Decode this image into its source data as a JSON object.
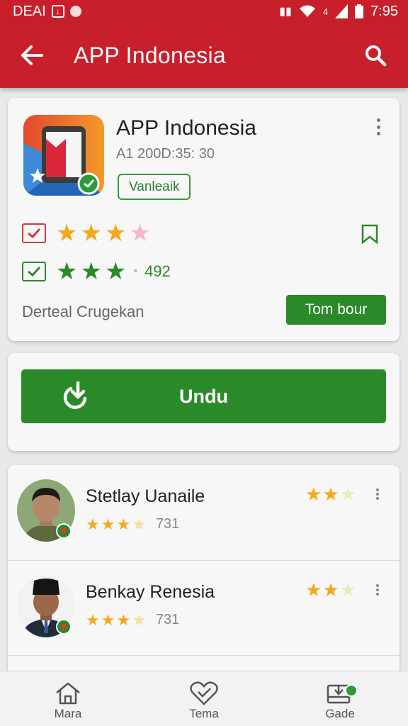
{
  "status_bar": {
    "carrier": "DEAI",
    "network_label": "4",
    "time": "7:95"
  },
  "app_bar": {
    "title": "APP Indonesia",
    "back_icon": "arrow-left-icon",
    "search_icon": "search-icon",
    "color": "#c8202b"
  },
  "app_card": {
    "name": "APP Indonesia",
    "meta": "A1 200D:35: 30",
    "tag": "Vanleaik",
    "rating_rows": [
      {
        "icon": "red-check-icon",
        "stars_filled": 3,
        "stars_total": 4,
        "count": ""
      },
      {
        "icon": "green-check-icon",
        "stars_filled": 3,
        "stars_total": 3,
        "count": "492"
      }
    ],
    "developer": "Derteal Crugekan",
    "action_button": "Tom bour",
    "accent_green": "#2a8a2a"
  },
  "download": {
    "label": "Undu",
    "icon": "download-refresh-icon"
  },
  "reviews": [
    {
      "name": "Stetlay Uanaile",
      "stars": 3.5,
      "count": "731",
      "top_stars": 2.5
    },
    {
      "name": "Benkay Renesia",
      "stars": 3.5,
      "count": "731",
      "top_stars": 2.5
    }
  ],
  "bottom_nav": [
    {
      "label": "Mara",
      "icon": "home-icon"
    },
    {
      "label": "Tema",
      "icon": "heart-check-icon"
    },
    {
      "label": "Gade",
      "icon": "inbox-download-icon"
    }
  ]
}
